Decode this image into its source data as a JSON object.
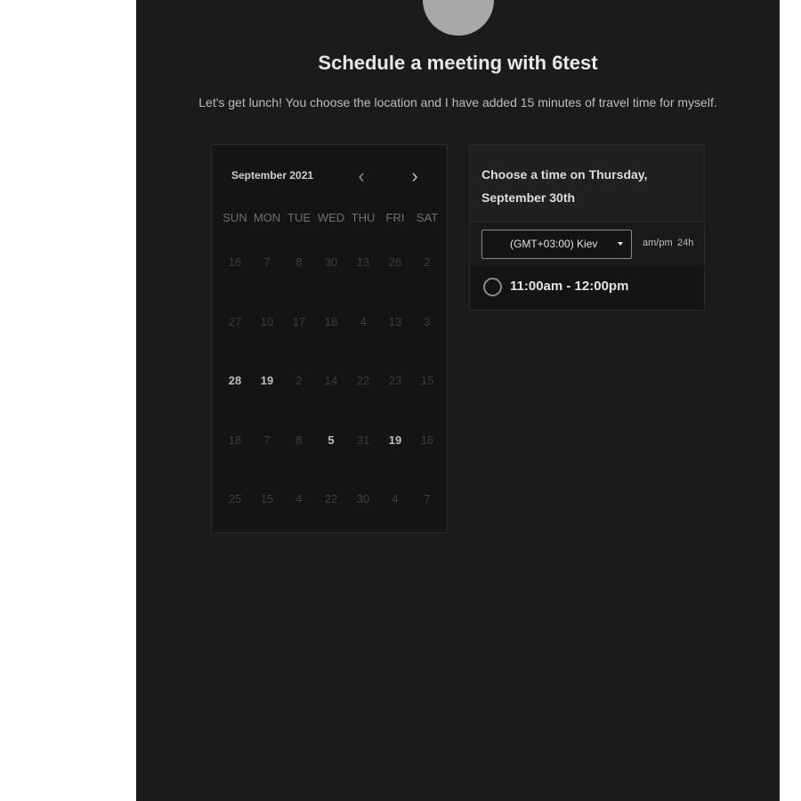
{
  "header": {
    "title": "Schedule a meeting with 6test",
    "description": "Let's get lunch! You choose the location and I have added 15 minutes of travel time for myself."
  },
  "calendar": {
    "month_label": "September 2021",
    "prev_icon": "‹",
    "next_icon": "›",
    "weekdays": [
      "SUN",
      "MON",
      "TUE",
      "WED",
      "THU",
      "FRI",
      "SAT"
    ],
    "weeks": [
      [
        "16",
        "7",
        "8",
        "30",
        "13",
        "26",
        "2"
      ],
      [
        "27",
        "10",
        "17",
        "18",
        "4",
        "13",
        "3"
      ],
      [
        "28",
        "19",
        "2",
        "14",
        "22",
        "23",
        "15"
      ],
      [
        "18",
        "7",
        "8",
        "5",
        "31",
        "19",
        "16"
      ],
      [
        "25",
        "15",
        "4",
        "22",
        "30",
        "4",
        "7"
      ]
    ],
    "active_days": [
      [
        2,
        0
      ],
      [
        2,
        1
      ],
      [
        3,
        3
      ],
      [
        3,
        5
      ]
    ]
  },
  "time_panel": {
    "heading_line1": "Choose a time on Thursday,",
    "heading_line2": "September 30th",
    "timezone": "(GMT+03:00) Kiev",
    "format_ampm": "am/pm",
    "format_24h": "24h",
    "slots": [
      "11:00am - 12:00pm"
    ]
  },
  "colors": {
    "background": "#1b1b1b",
    "card": "#141414"
  }
}
